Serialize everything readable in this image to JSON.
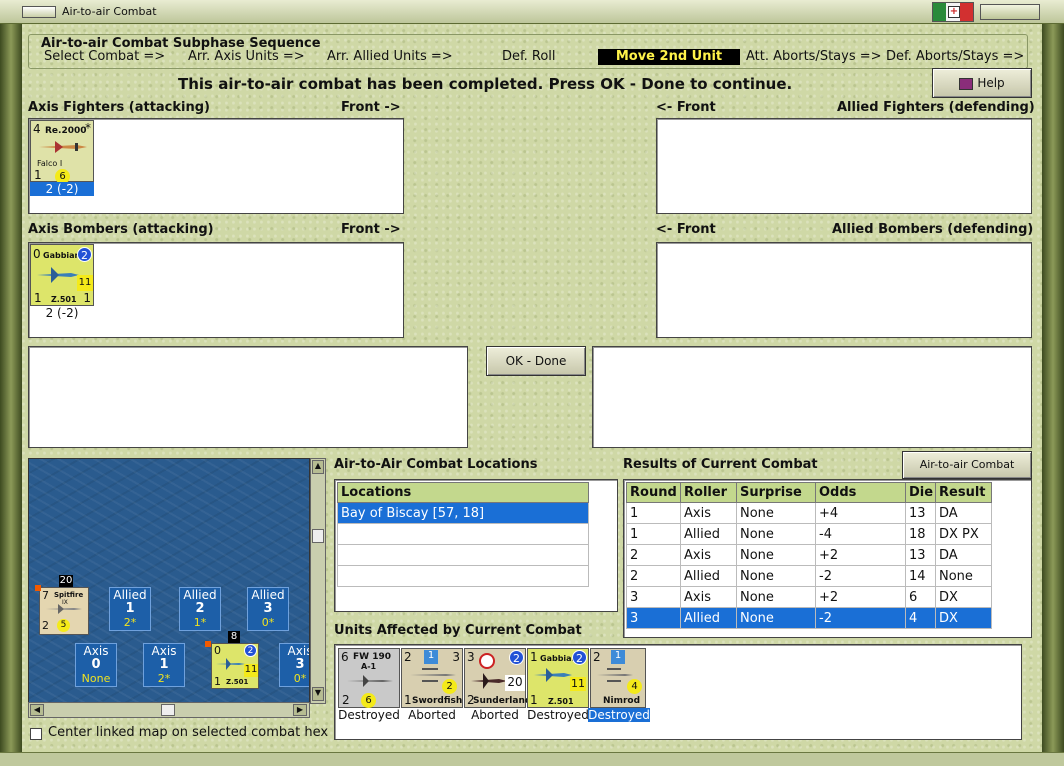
{
  "window": {
    "title": "Air-to-air Combat"
  },
  "subphase": {
    "title": "Air-to-air Combat Subphase Sequence",
    "steps": [
      "Select Combat =>",
      "Arr. Axis Units =>",
      "Arr. Allied Units =>",
      "Def. Roll",
      "Move 2nd Unit",
      "Att. Aborts/Stays =>",
      "Def. Aborts/Stays =>"
    ]
  },
  "message": "This air-to-air combat has been completed.  Press OK - Done to continue.",
  "help_label": "Help",
  "panels": {
    "axis_fighters": "Axis Fighters (attacking)",
    "front_right": "Front ->",
    "allied_fighters": "Allied Fighters (defending)",
    "front_left": "<- Front",
    "axis_bombers": "Axis Bombers (attacking)",
    "allied_bombers": "Allied Bombers (defending)"
  },
  "axis_fighter_unit": {
    "top": "4",
    "name": "Re.2000",
    "sub": "Falco I",
    "bl": "1",
    "val": "6",
    "star": "*",
    "caption": "2 (-2)"
  },
  "axis_bomber_unit": {
    "top": "0",
    "name": "Gabbiano",
    "badge": "2",
    "val": "11",
    "bl": "1",
    "br": "1",
    "model": "Z.501",
    "caption": "2 (-2)"
  },
  "ok_label": "OK - Done",
  "map": {
    "spitfire": {
      "count": "20",
      "top": "7",
      "name": "Spitfire",
      "sub": "IX",
      "bl": "2",
      "val": "5"
    },
    "gabbiano": {
      "count": "8",
      "top": "0",
      "badge": "2",
      "val": "11",
      "bl": "1",
      "model": "Z.501"
    },
    "hexes": [
      {
        "side": "Allied",
        "n": "1",
        "v": "2*"
      },
      {
        "side": "Allied",
        "n": "2",
        "v": "1*"
      },
      {
        "side": "Allied",
        "n": "3",
        "v": "0*"
      },
      {
        "side": "Axis",
        "n": "0",
        "v": "None"
      },
      {
        "side": "Axis",
        "n": "1",
        "v": "2*"
      },
      {
        "side": "Axis",
        "n": "3",
        "v": "0*"
      }
    ]
  },
  "center_map_label": "Center linked map on selected combat hex",
  "locations": {
    "title": "Air-to-Air Combat Locations",
    "header": "Locations",
    "rows": [
      "Bay of Biscay [57, 18]"
    ]
  },
  "results": {
    "title": "Results of Current Combat",
    "chart_btn": "Air-to-air Combat Chart",
    "headers": [
      "Round",
      "Roller",
      "Surprise",
      "Odds",
      "Die",
      "Result"
    ],
    "rows": [
      [
        "1",
        "Axis",
        "None",
        "+4",
        "13",
        "DA"
      ],
      [
        "1",
        "Allied",
        "None",
        "-4",
        "18",
        "DX PX"
      ],
      [
        "2",
        "Axis",
        "None",
        "+2",
        "13",
        "DA"
      ],
      [
        "2",
        "Allied",
        "None",
        "-2",
        "14",
        "None"
      ],
      [
        "3",
        "Axis",
        "None",
        "+2",
        "6",
        "DX"
      ],
      [
        "3",
        "Allied",
        "None",
        "-2",
        "4",
        "DX"
      ]
    ]
  },
  "affected": {
    "title": "Units Affected by Current Combat",
    "units": [
      {
        "name": "FW 190",
        "sub": "A-1",
        "top": "6",
        "bl": "2",
        "val": "6",
        "caption": "Destroyed"
      },
      {
        "name": "Swordfish",
        "top": "2",
        "badge": "1",
        "tr": "3",
        "bl": "1",
        "val": "2",
        "caption": "Aborted"
      },
      {
        "name": "Sunderland",
        "top": "3",
        "badge": "2",
        "bl": "2",
        "val": "20",
        "caption": "Aborted"
      },
      {
        "name": "Gabbiano",
        "model": "Z.501",
        "top": "1",
        "badge": "2",
        "bl": "1",
        "val": "11",
        "caption": "Destroyed"
      },
      {
        "name": "Nimrod",
        "top": "2",
        "badge": "1",
        "val": "4",
        "caption": "Destroyed"
      }
    ]
  },
  "colors": {
    "accent": "#1a6fd6",
    "background": "#cfd8a6",
    "active_step": "#000000"
  }
}
